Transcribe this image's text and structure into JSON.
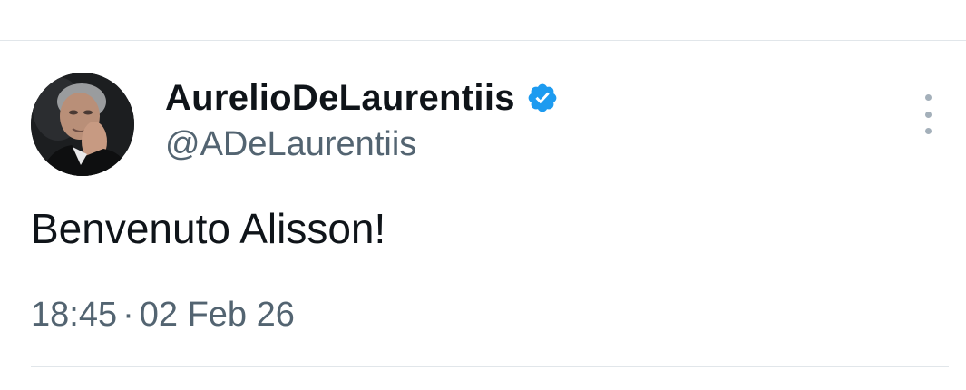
{
  "tweet": {
    "author": {
      "display_name": "AurelioDeLaurentiis",
      "handle": "@ADeLaurentiis",
      "verified_icon": "verified-badge-icon",
      "avatar_icon": "profile-photo"
    },
    "text": "Benvenuto Alisson!",
    "time": "18:45",
    "separator": "·",
    "date": "02 Feb 26",
    "more_icon": "more-vertical-icon"
  },
  "colors": {
    "text_primary": "#0f1419",
    "text_secondary": "#536471",
    "verified_blue": "#1d9bf0",
    "divider": "#e1e6ea",
    "more_dots": "#a4b0ba"
  }
}
